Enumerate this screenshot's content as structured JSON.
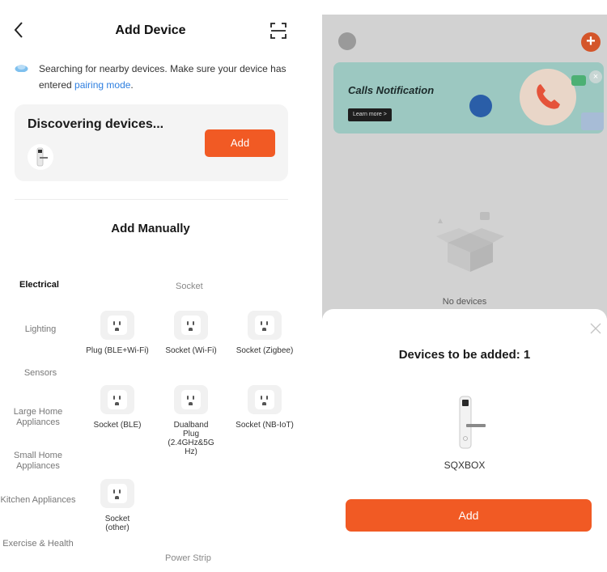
{
  "left": {
    "header": {
      "title": "Add Device"
    },
    "search": {
      "text": "Searching for nearby devices. Make sure your device has entered ",
      "link": "pairing mode",
      "suffix": "."
    },
    "discover": {
      "title": "Discovering devices...",
      "add_label": "Add"
    },
    "manual_title": "Add Manually",
    "categories": [
      "Electrical",
      "Lighting",
      "Sensors",
      "Large Home Appliances",
      "Small Home Appliances",
      "Kitchen Appliances",
      "Exercise & Health"
    ],
    "sections": [
      "Socket",
      "Power Strip"
    ],
    "devices": [
      {
        "name": "Plug (BLE+Wi-Fi)"
      },
      {
        "name": "Socket (Wi-Fi)"
      },
      {
        "name": "Socket (Zigbee)"
      },
      {
        "name": "Socket (BLE)"
      },
      {
        "name": "Dualband Plug (2.4GHz&5G Hz)"
      },
      {
        "name": "Socket (NB-IoT)"
      },
      {
        "name": "Socket (other)"
      }
    ]
  },
  "right": {
    "banner": {
      "title": "Calls Notification",
      "button": "Learn more >"
    },
    "empty_text": "No devices",
    "sheet": {
      "title": "Devices to be added: 1",
      "device_name": "SQXBOX",
      "add_label": "Add"
    }
  },
  "colors": {
    "accent": "#f15a24",
    "link": "#2e7fe0",
    "overlay": "#d2d2d2",
    "banner": "#9cc8c1"
  }
}
